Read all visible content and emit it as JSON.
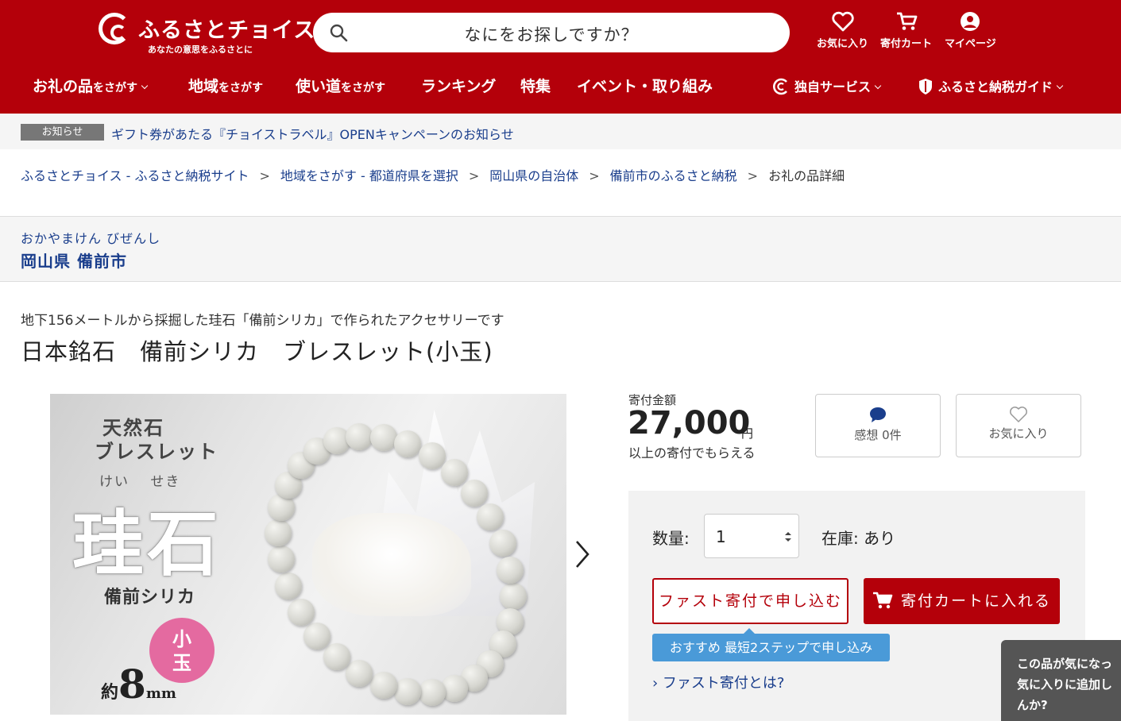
{
  "header": {
    "logo_text": "ふるさとチョイス",
    "logo_tagline": "あなたの意思をふるさとに",
    "search_placeholder": "なにをお探しですか？",
    "favorites_label": "お気に入り",
    "cart_label": "寄付カート",
    "mypage_label": "マイページ"
  },
  "nav": {
    "items": [
      {
        "main": "お礼の品",
        "sub": "をさがす"
      },
      {
        "main": "地域",
        "sub": "をさがす"
      },
      {
        "main": "使い道",
        "sub": "をさがす"
      },
      {
        "main": "ランキング"
      },
      {
        "main": "特集"
      },
      {
        "main": "イベント・取り組み"
      }
    ],
    "service_label": "独自サービス",
    "guide_label": "ふるさと納税ガイド"
  },
  "notice": {
    "badge": "お知らせ",
    "text": "ギフト券があたる『チョイストラベル』OPENキャンペーンのお知らせ"
  },
  "breadcrumb": {
    "items": [
      "ふるさとチョイス - ふるさと納税サイト",
      "地域をさがす - 都道府県を選択",
      "岡山県の自治体",
      "備前市のふるさと納税"
    ],
    "sep": ">",
    "current": "お礼の品詳細"
  },
  "municipality": {
    "kana": "おかやまけん びぜんし",
    "name": "岡山県 備前市"
  },
  "product": {
    "catch": "地下156メートルから採掘した珪石「備前シリカ」で作られたアクセサリーです",
    "title": "日本銘石　備前シリカ　ブレスレット(小玉)",
    "image": {
      "line1": "天然石",
      "line2": "ブレスレット",
      "ruby": "けい　 せき",
      "big": "珪石",
      "sub": "備前シリカ",
      "circle_top": "小",
      "circle_bottom": "玉",
      "size_about": "約",
      "size_num": "8",
      "size_unit": "mm"
    }
  },
  "price": {
    "label": "寄付金額",
    "amount": "27,000",
    "unit": "円",
    "note": "以上の寄付でもらえる"
  },
  "actions": {
    "review_label": "感想 0件",
    "favorite_label": "お気に入り",
    "qty_label": "数量:",
    "qty_value": "1",
    "stock": "在庫: あり",
    "fast_button": "ファスト寄付で申し込む",
    "cart_button": "寄付カートに入れる",
    "recommend": "おすすめ 最短2ステップで申し込み",
    "fast_link": "› ファスト寄付とは?"
  },
  "popup": {
    "line1": "この品が気になっ",
    "line2": "気に入りに追加し",
    "line3": "んか?"
  },
  "colors": {
    "brand_red": "#b4000a",
    "link_blue": "#1a3e8c",
    "recommend_blue": "#4a9ad8"
  }
}
